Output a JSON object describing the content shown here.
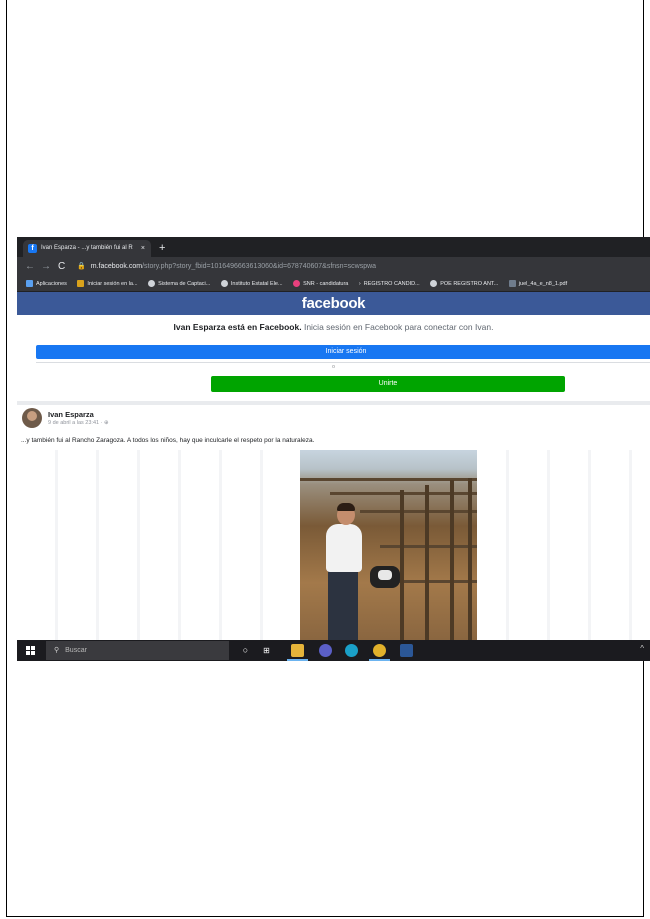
{
  "browser": {
    "tab_title": "Ivan Esparza - ...y también fui al R",
    "tab_close": "×",
    "new_tab": "+",
    "url_host": "m.facebook.com",
    "url_path": "/story.php?story_fbid=1016496663613060&id=678740607&sfnsn=scwspwa",
    "bookmarks": [
      {
        "label": "Aplicaciones",
        "icon": "apps-grid-icon"
      },
      {
        "label": "Iniciar sesión en la...",
        "icon": "square-logo-icon"
      },
      {
        "label": "Sistema de Captaci...",
        "icon": "globe-icon"
      },
      {
        "label": "Instituto Estatal Ele...",
        "icon": "globe-icon"
      },
      {
        "label": "SNR - candidatura",
        "icon": "pink-dot-icon"
      },
      {
        "label": "REGISTRO CANDID...",
        "icon": "arrow-icon"
      },
      {
        "label": "POE REGISTRO ANT...",
        "icon": "globe-icon"
      },
      {
        "label": "juel_4a_e_n8_1.pdf",
        "icon": "document-icon"
      }
    ]
  },
  "facebook": {
    "logo": "facebook",
    "promo_name": "Ivan Esparza está en Facebook.",
    "promo_rest": "Inicia sesión en Facebook para conectar con Ivan.",
    "login_button": "Iniciar sesión",
    "or_text": "o",
    "join_button": "Unirte",
    "post": {
      "author": "Ivan Esparza",
      "time": "9 de abril a las 23:41 · ⊕",
      "caption": "...y también fui al Rancho Zaragoza. A todos los niños, hay que inculcarle el respeto por la naturaleza."
    }
  },
  "taskbar": {
    "search_placeholder": "Buscar",
    "apps": [
      "task-view-icon",
      "file-explorer-icon",
      "teams-icon",
      "edge-icon",
      "chrome-icon",
      "word-icon"
    ]
  }
}
